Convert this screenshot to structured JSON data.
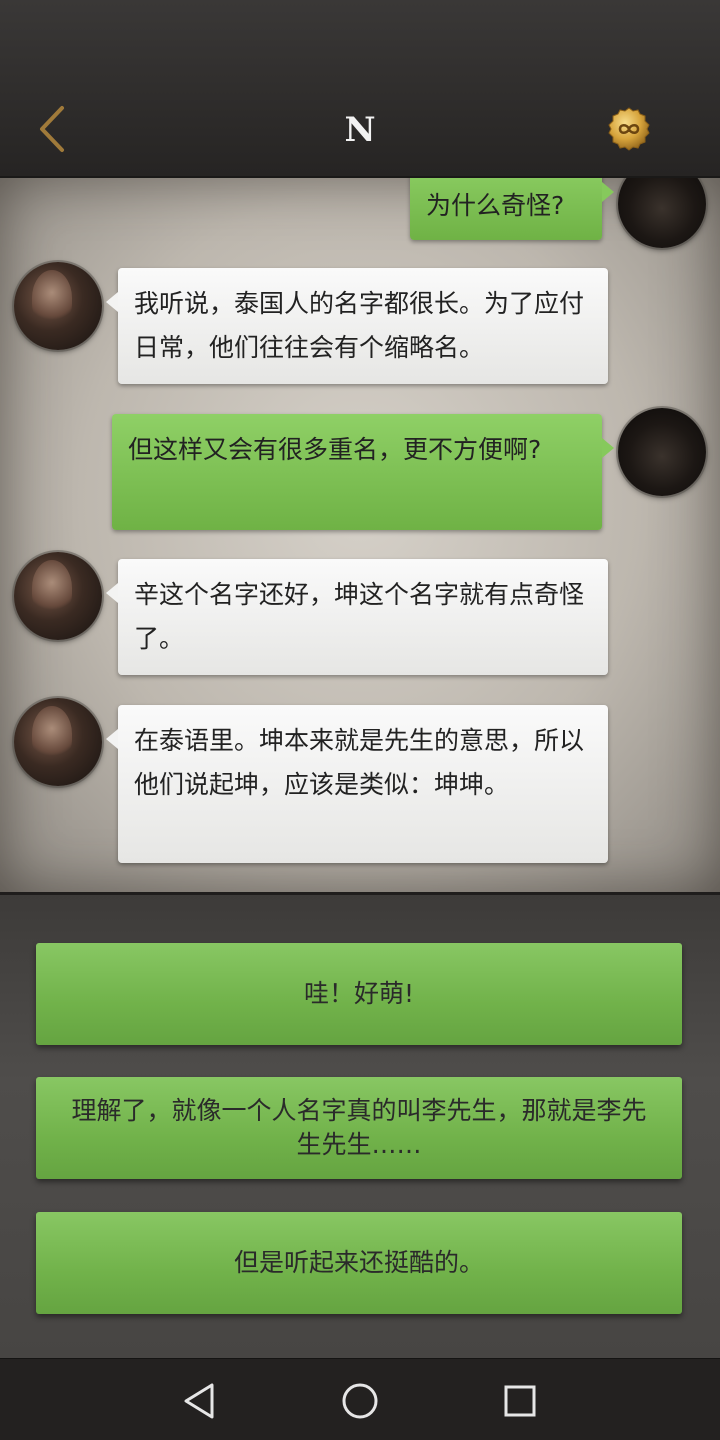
{
  "header": {
    "title": "N",
    "back_icon": "chevron-left-icon",
    "badge_icon": "infinity-badge-icon",
    "accent_color": "#a07a3a"
  },
  "messages": [
    {
      "sender": "player",
      "text": "为什么奇怪?"
    },
    {
      "sender": "npc",
      "text": "我听说，泰国人的名字都很长。为了应付日常，他们往往会有个缩略名。"
    },
    {
      "sender": "player",
      "text": "但这样又会有很多重名，更不方便啊?"
    },
    {
      "sender": "npc",
      "text": "辛这个名字还好，坤这个名字就有点奇怪了。"
    },
    {
      "sender": "npc",
      "text": "在泰语里。坤本来就是先生的意思，所以他们说起坤，应该是类似：坤坤。"
    }
  ],
  "choices": [
    {
      "label": "哇！好萌!"
    },
    {
      "label": "理解了，就像一个人名字真的叫李先生，那就是李先生先生……"
    },
    {
      "label": "但是听起来还挺酷的。"
    }
  ],
  "navbar": {
    "back_icon": "triangle-back-icon",
    "home_icon": "circle-home-icon",
    "recents_icon": "square-recents-icon"
  },
  "colors": {
    "player_bubble": "#7fc255",
    "npc_bubble": "#f2f2f1",
    "choice_button": "#78b84f"
  }
}
